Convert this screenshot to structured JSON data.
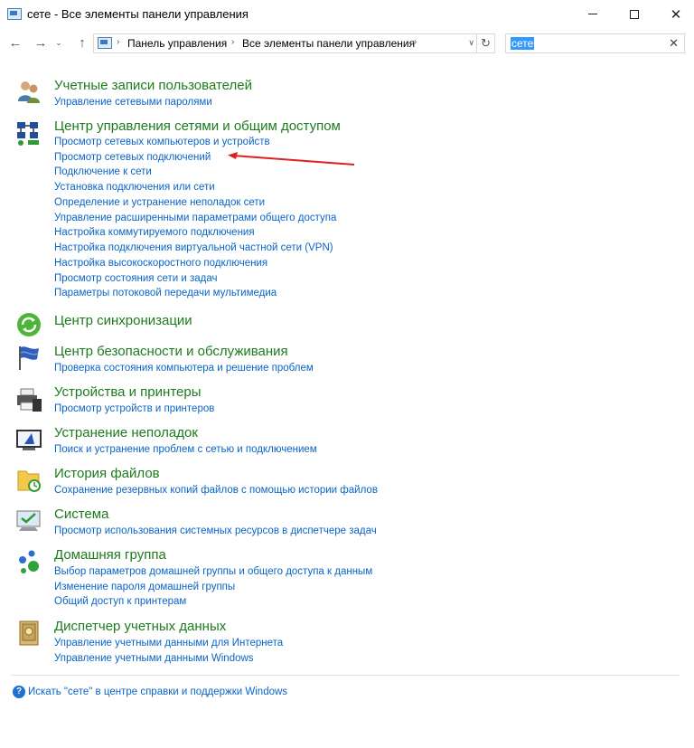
{
  "window": {
    "title": "сете - Все элементы панели управления",
    "minimize": "—",
    "maximize": "☐",
    "close": "✕"
  },
  "nav": {
    "back": "←",
    "forward": "→",
    "dropdown": "⌄",
    "up": "↑",
    "breadcrumb": [
      "Панель управления",
      "Все элементы панели управления"
    ],
    "breadcrumb_sep": "›",
    "address_dropdown": "∨",
    "refresh": "↻"
  },
  "search": {
    "value": "сете",
    "clear": "✕"
  },
  "groups": [
    {
      "title": "Учетные записи пользователей",
      "icon": "user-accounts-icon",
      "links": [
        "Управление сетевыми паролями"
      ]
    },
    {
      "title": "Центр управления сетями и общим доступом",
      "icon": "network-center-icon",
      "links": [
        "Просмотр сетевых компьютеров и устройств",
        "Просмотр сетевых подключений",
        "Подключение к сети",
        "Установка подключения или сети",
        "Определение и устранение неполадок сети",
        "Управление расширенными параметрами общего доступа",
        "Настройка коммутируемого подключения",
        "Настройка подключения виртуальной частной сети (VPN)",
        "Настройка высокоскоростного подключения",
        "Просмотр состояния сети и задач",
        "Параметры потоковой передачи мультимедиа"
      ]
    },
    {
      "title": "Центр синхронизации",
      "icon": "sync-center-icon",
      "links": []
    },
    {
      "title": "Центр безопасности и обслуживания",
      "icon": "security-flag-icon",
      "links": [
        "Проверка состояния компьютера и решение проблем"
      ]
    },
    {
      "title": "Устройства и принтеры",
      "icon": "printer-icon",
      "links": [
        "Просмотр устройств и принтеров"
      ]
    },
    {
      "title": "Устранение неполадок",
      "icon": "troubleshoot-icon",
      "links": [
        "Поиск и устранение проблем с сетью и подключением"
      ]
    },
    {
      "title": "История файлов",
      "icon": "file-history-icon",
      "links": [
        "Сохранение резервных копий файлов с помощью истории файлов"
      ]
    },
    {
      "title": "Система",
      "icon": "system-monitor-icon",
      "links": [
        "Просмотр использования системных ресурсов в диспетчере задач"
      ]
    },
    {
      "title": "Домашняя группа",
      "icon": "homegroup-icon",
      "links": [
        "Выбор параметров домашней группы и общего доступа к данным",
        "Изменение пароля домашней группы",
        "Общий доступ к принтерам"
      ]
    },
    {
      "title": "Диспетчер учетных данных",
      "icon": "credential-vault-icon",
      "links": [
        "Управление учетными данными для Интернета",
        "Управление учетными данными Windows"
      ]
    }
  ],
  "help": {
    "icon": "?",
    "text": "Искать \"сете\" в центре справки и поддержки Windows"
  },
  "colors": {
    "group_title": "#1e7b1e",
    "link": "#0a64c8",
    "annotation_arrow": "#e02020",
    "search_highlight": "#3399ff"
  }
}
